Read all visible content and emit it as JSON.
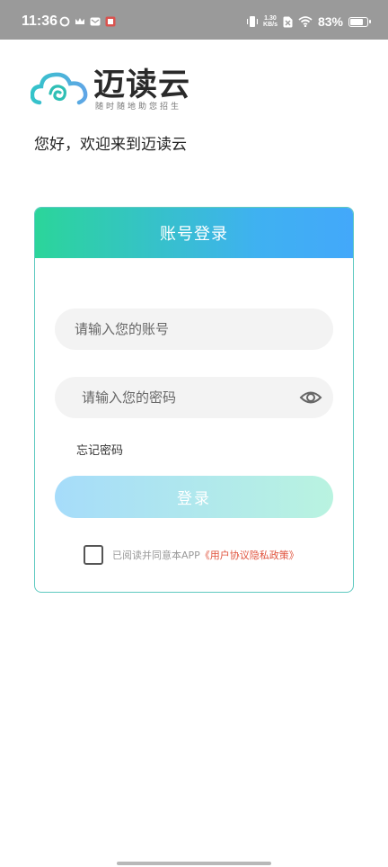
{
  "status_bar": {
    "time": "11:36",
    "net_speed_value": "1.30",
    "net_speed_unit": "KB/s",
    "battery_percent": "83%",
    "battery_level": 0.83
  },
  "logo": {
    "name": "迈读云",
    "slogan": "随时随地助您招生"
  },
  "greeting": "您好，欢迎来到迈读云",
  "login_card": {
    "title": "账号登录",
    "account_placeholder": "请输入您的账号",
    "password_placeholder": "请输入您的密码",
    "forgot_password": "忘记密码",
    "login_button": "登录",
    "agreement_prefix": "已阅读并同意本APP",
    "agreement_link": "《用户协议隐私政策》"
  },
  "colors": {
    "header_gradient_start": "#2bd59a",
    "header_gradient_end": "#43a8fa",
    "card_border": "#5ec9c0",
    "link": "#e0533d"
  }
}
